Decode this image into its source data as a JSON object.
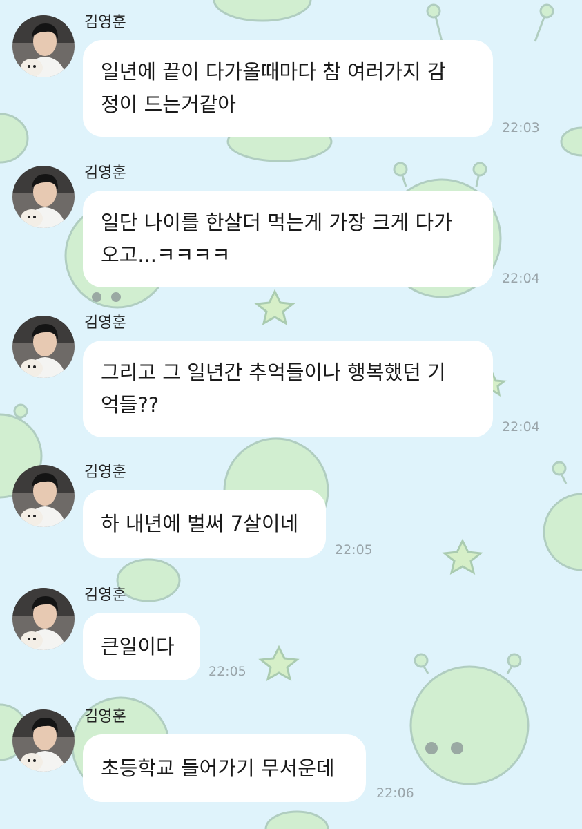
{
  "messages": [
    {
      "sender": "김영훈",
      "text": "일년에 끝이 다가올때마다 참 여러가지 감\n정이 드는거같아",
      "time": "22:03"
    },
    {
      "sender": "김영훈",
      "text": "일단 나이를 한살더 먹는게 가장 크게 다가\n오고...ㅋㅋㅋㅋ",
      "time": "22:04"
    },
    {
      "sender": "김영훈",
      "text": "그리고 그 일년간 추억들이나 행복했던 기\n억들??",
      "time": "22:04"
    },
    {
      "sender": "김영훈",
      "text": "하 내년에 벌써 7살이네",
      "time": "22:05"
    },
    {
      "sender": "김영훈",
      "text": "큰일이다",
      "time": "22:05"
    },
    {
      "sender": "김영훈",
      "text": "초등학교 들어가기 무서운데",
      "time": "22:06"
    }
  ],
  "colors": {
    "background": "#dff3fb",
    "bubble": "#ffffff",
    "timestamp": "#9aa5aa",
    "wallpaper_character": "#cfeec9"
  },
  "icons": {
    "avatar": "profile-photo",
    "wallpaper": "alien-character-pattern"
  }
}
